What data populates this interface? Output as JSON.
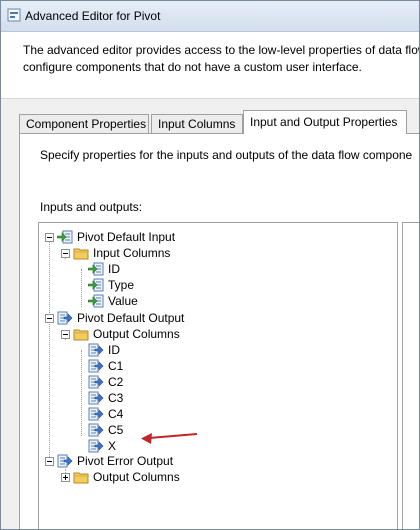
{
  "window": {
    "title": "Advanced Editor for Pivot"
  },
  "header": {
    "line1": "The advanced editor provides access to the low-level properties of data flow",
    "line2": "configure components that do not have a custom user interface."
  },
  "tabs": [
    {
      "label": "Component Properties",
      "active": false
    },
    {
      "label": "Input Columns",
      "active": false
    },
    {
      "label": "Input and Output Properties",
      "active": true
    }
  ],
  "panel": {
    "description": "Specify properties for the inputs and outputs of the data flow compone",
    "tree_label": "Inputs and outputs:"
  },
  "tree": {
    "input": {
      "label": "Pivot Default Input",
      "columns_folder": "Input Columns",
      "columns": [
        "ID",
        "Type",
        "Value"
      ]
    },
    "output": {
      "label": "Pivot Default Output",
      "columns_folder": "Output Columns",
      "columns": [
        "ID",
        "C1",
        "C2",
        "C3",
        "C4",
        "C5",
        "X"
      ]
    },
    "error_output": {
      "label": "Pivot Error Output",
      "columns_folder": "Output Columns"
    }
  },
  "annotation": {
    "arrow_color": "#c0272d",
    "points_to": "X"
  },
  "icons": {
    "input": "input-arrow-icon",
    "output": "output-arrow-icon",
    "folder": "folder-icon"
  }
}
